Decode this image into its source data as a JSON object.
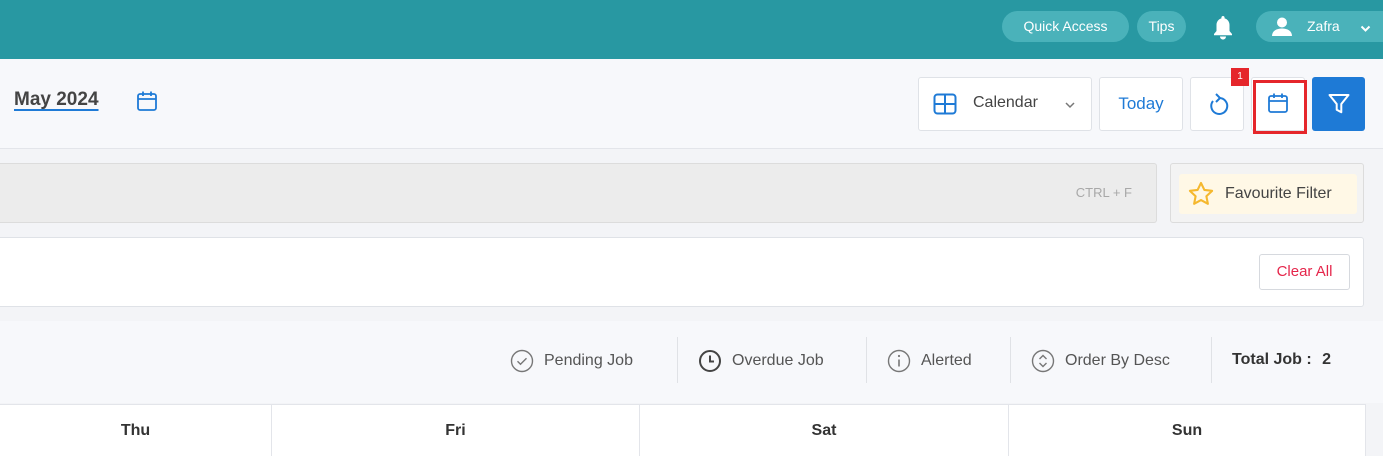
{
  "topbar": {
    "quick_access": "Quick Access",
    "tips": "Tips",
    "user_name": "Zafra",
    "bg_color": "#2898a2"
  },
  "header": {
    "month_title": "May 2024",
    "view_label": "Calendar",
    "today_label": "Today",
    "highlight_badge": "1"
  },
  "search": {
    "shortcut": "CTRL + F",
    "favourite_filter": "Favourite Filter"
  },
  "filters": {
    "clear_all": "Clear All"
  },
  "legend": {
    "pending": "Pending Job",
    "overdue": "Overdue Job",
    "alerted": "Alerted",
    "order": "Order By Desc",
    "total_label": "Total Job :",
    "total_value": "2"
  },
  "days": [
    "Thu",
    "Fri",
    "Sat",
    "Sun"
  ],
  "colors": {
    "accent": "#1e7ad6",
    "highlight": "#e5262b",
    "danger_text": "#e5264b",
    "star": "#f5b82e"
  }
}
